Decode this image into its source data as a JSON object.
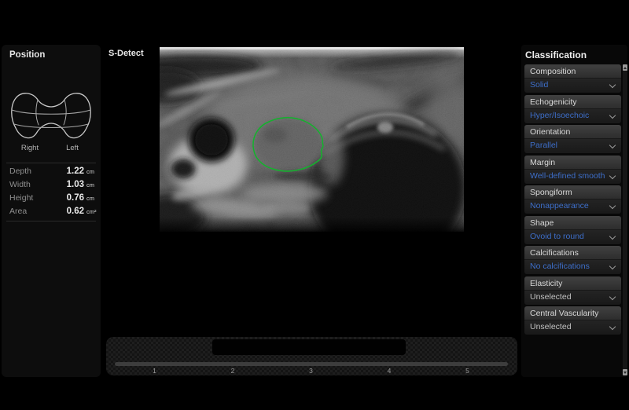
{
  "left_panel": {
    "title": "Position",
    "diagram": {
      "right_label": "Right",
      "left_label": "Left"
    },
    "measurements": [
      {
        "label": "Depth",
        "value": "1.22",
        "unit": "cm"
      },
      {
        "label": "Width",
        "value": "1.03",
        "unit": "cm"
      },
      {
        "label": "Height",
        "value": "0.76",
        "unit": "cm"
      },
      {
        "label": "Area",
        "value": "0.62",
        "unit": "cm²"
      }
    ]
  },
  "main": {
    "mode_label": "S-Detect"
  },
  "classification_panel": {
    "title": "Classification",
    "sections": [
      {
        "label": "Composition",
        "value": "Solid",
        "selected": true
      },
      {
        "label": "Echogenicity",
        "value": "Hyper/Isoechoic",
        "selected": true
      },
      {
        "label": "Orientation",
        "value": "Parallel",
        "selected": true
      },
      {
        "label": "Margin",
        "value": "Well-defined smooth",
        "selected": true
      },
      {
        "label": "Spongiform",
        "value": "Nonappearance",
        "selected": true
      },
      {
        "label": "Shape",
        "value": "Ovoid to round",
        "selected": true
      },
      {
        "label": "Calcifications",
        "value": "No calcifications",
        "selected": true
      },
      {
        "label": "Elasticity",
        "value": "Unselected",
        "selected": false
      },
      {
        "label": "Central Vascularity",
        "value": "Unselected",
        "selected": false
      }
    ]
  },
  "filmstrip": {
    "tick_labels": [
      "1",
      "2",
      "3",
      "4",
      "5"
    ]
  },
  "colors": {
    "accent_blue": "#3d6ec9",
    "contour_green": "#12b42c",
    "background": "#000000"
  }
}
